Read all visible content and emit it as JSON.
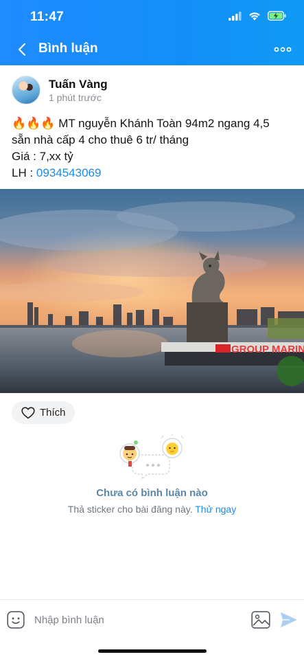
{
  "status_bar": {
    "time": "11:47",
    "battery_charging": true
  },
  "header": {
    "title": "Bình luận",
    "back_icon": "chevron-left-icon",
    "more_icon": "more-horizontal-icon"
  },
  "post": {
    "author": "Tuấn Vàng",
    "time": "1 phút trước",
    "line1": "🔥🔥🔥 MT nguyễn Khánh Toàn 94m2 ngang 4,5",
    "line2": "sẵn nhà cấp 4 cho thuê 6 tr/ tháng",
    "line3": "Giá : 7,xx tỷ",
    "contact_label": "LH : ",
    "phone": "0934543069",
    "photo_sign": "GROUP MARIN"
  },
  "actions": {
    "like_label": "Thích"
  },
  "empty_state": {
    "title": "Chưa có bình luận nào",
    "subtitle": "Thả sticker cho bài đăng này. ",
    "try_link": "Thử ngay"
  },
  "composer": {
    "placeholder": "Nhập bình luận"
  },
  "colors": {
    "header": "#1e8bff",
    "accent": "#1a8cf0",
    "empty_title": "#5b86ac"
  }
}
